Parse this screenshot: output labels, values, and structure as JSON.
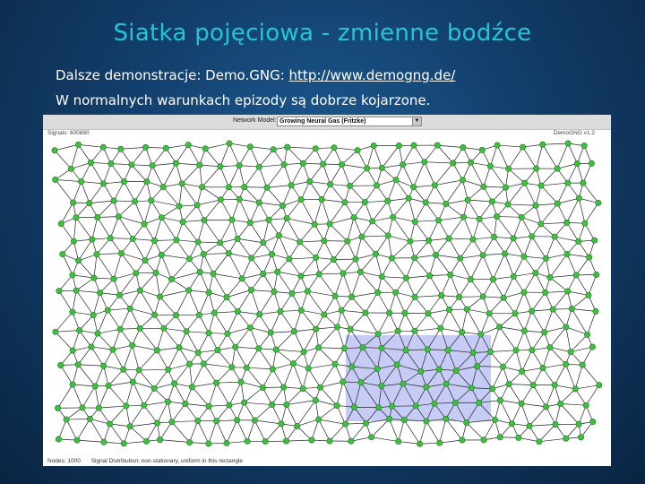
{
  "slide": {
    "title": "Siatka pojęciowa - zmienne bodźce",
    "bullet1_prefix": "Dalsze demonstracje: Demo.GNG:",
    "bullet1_link": "http://www.demogng.de/",
    "bullet2": "W normalnych warunkach epizody są dobrze kojarzone."
  },
  "applet": {
    "network_mode_label": "Network Model:",
    "network_mode_value": "Growing Neural Gas (Fritzke)",
    "signals_text": "Signals: 600880",
    "version_text": "DemoGNG v1.2",
    "nodes_text": "Nodes: 1000",
    "distribution_text": "Signal Distribution: non-stationary, uniform in this rectangle",
    "node_color": "#3fbf3f",
    "edge_color": "#222222",
    "region_color": "#c6ccf6"
  }
}
